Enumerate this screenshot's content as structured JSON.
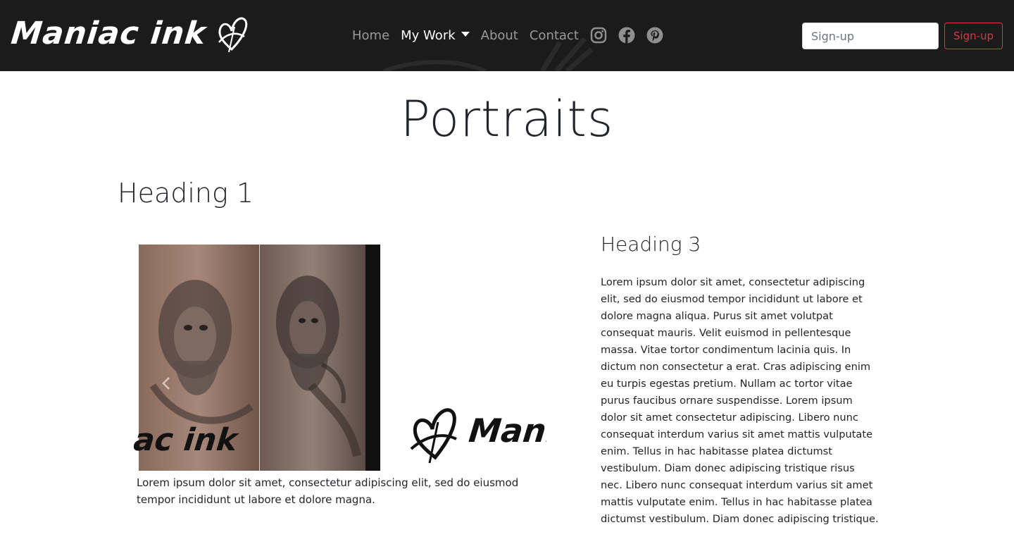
{
  "navbar": {
    "brand_text": "Maniac ink",
    "links": [
      {
        "label": "Home"
      },
      {
        "label": "My Work"
      },
      {
        "label": "About"
      },
      {
        "label": "Contact"
      }
    ],
    "social_icons": [
      "instagram-icon",
      "facebook-icon",
      "pinterest-icon"
    ],
    "signup": {
      "placeholder": "Sign-up",
      "button_label": "Sign-up"
    }
  },
  "main": {
    "title": "Portraits",
    "heading_1": "Heading 1",
    "carousel": {
      "logo_left_text": "ac ink",
      "logo_right_text": "Mania",
      "caption": "Lorem ipsum dolor sit amet, consectetur adipiscing elit, sed do eiusmod tempor incididunt ut labore et dolore magna."
    },
    "heading_3": "Heading 3",
    "body": "Lorem ipsum dolor sit amet, consectetur adipiscing elit, sed do eiusmod tempor incididunt ut labore et dolore magna aliqua. Purus sit amet volutpat consequat mauris. Velit euismod in pellentesque massa. Vitae tortor condimentum lacinia quis. In dictum non consectetur a erat. Cras adipiscing enim eu turpis egestas pretium. Nullam ac tortor vitae purus faucibus ornare suspendisse. Lorem ipsum dolor sit amet consectetur adipiscing. Libero nunc consequat interdum varius sit amet mattis vulputate enim. Tellus in hac habitasse platea dictumst vestibulum. Diam donec adipiscing tristique risus nec. Libero nunc consequat interdum varius sit amet mattis vulputate enim. Tellus in hac habitasse platea dictumst vestibulum. Diam donec adipiscing tristique."
  },
  "colors": {
    "navbar_bg": "#1b1b1b",
    "accent_red": "#dc3545",
    "text": "#212529"
  }
}
